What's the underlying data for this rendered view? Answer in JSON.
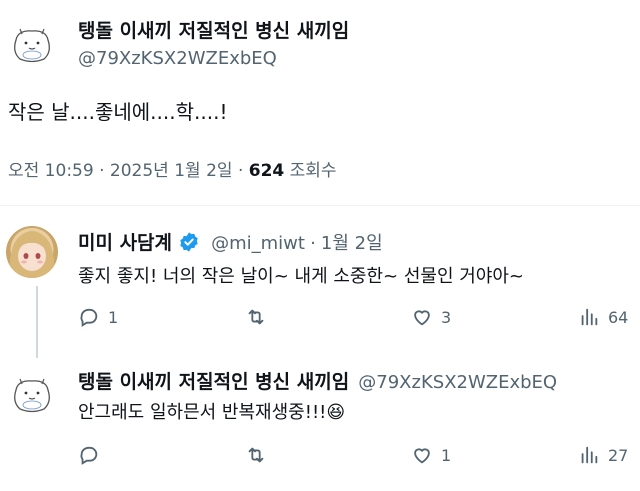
{
  "main_post": {
    "author_name": "탱돌 이새끼 저질적인 병신 새끼임",
    "author_handle": "@79XzKSX2WZExbEQ",
    "text": "작은 날....좋네에....학....!",
    "time": "오전 10:59",
    "date": "2025년 1월 2일",
    "sep": "·",
    "views_count": "624",
    "views_label": "조회수"
  },
  "reply1": {
    "author_name": "미미 사담계",
    "author_handle": "@mi_miwt",
    "date": "1월 2일",
    "sep": "·",
    "text": "좋지 좋지! 너의 작은 날이~ 내게 소중한~ 선물인 거야아~",
    "replies": "1",
    "retweets": "",
    "likes": "3",
    "views": "64",
    "verified_color": "#1d9bf0"
  },
  "reply2": {
    "author_name": "탱돌 이새끼 저질적인 병신 새끼임",
    "author_handle": "@79XzKSX2WZExbEQ",
    "text": "안그래도 일하믄서 반복재생중!!!",
    "emoji": "😆",
    "replies": "",
    "retweets": "",
    "likes": "1",
    "views": "27"
  },
  "icons": [
    "sketch-avatar-icon",
    "reply-icon",
    "retweet-icon",
    "like-icon",
    "views-icon",
    "verified-badge-icon"
  ]
}
